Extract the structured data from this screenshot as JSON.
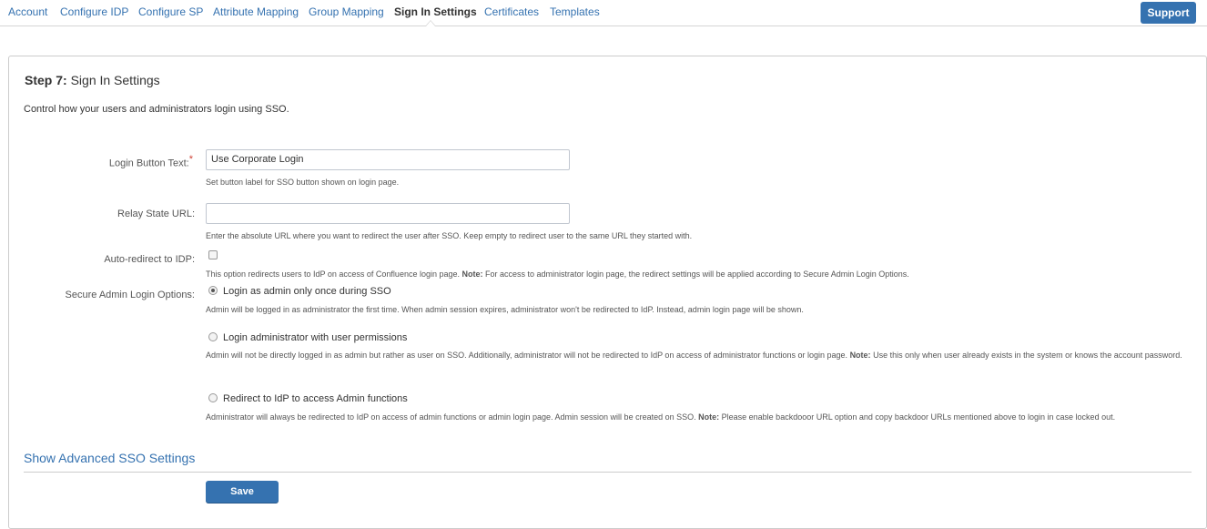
{
  "nav": {
    "tabs": [
      {
        "label": "Account"
      },
      {
        "label": "Configure IDP"
      },
      {
        "label": "Configure SP"
      },
      {
        "label": "Attribute Mapping"
      },
      {
        "label": "Group Mapping"
      },
      {
        "label": "Sign In Settings",
        "active": true
      },
      {
        "label": "Certificates"
      },
      {
        "label": "Templates"
      }
    ],
    "support_label": "Support"
  },
  "step": {
    "prefix": "Step 7:",
    "title": "Sign In Settings",
    "intro": "Control how your users and administrators login using SSO."
  },
  "fields": {
    "login_button_text": {
      "label": "Login Button Text:",
      "required_mark": "*",
      "value": "Use Corporate Login",
      "help": "Set button label for SSO button shown on login page."
    },
    "relay_state_url": {
      "label": "Relay State URL:",
      "value": "",
      "help": "Enter the absolute URL where you want to redirect the user after SSO. Keep empty to redirect user to the same URL they started with."
    },
    "auto_redirect": {
      "label": "Auto-redirect to IDP:",
      "checked": false,
      "help_pre": "This option redirects users to IdP on access of Confluence login page.",
      "help_note": "Note:",
      "help_post": "For access to administrator login page, the redirect settings will be applied according to Secure Admin Login Options."
    },
    "secure_admin": {
      "label": "Secure Admin Login Options:",
      "options": [
        {
          "label": "Login as admin only once during SSO",
          "checked": true,
          "help_pre": "Admin will be logged in as administrator the first time. When admin session expires, administrator won't be redirected to IdP. Instead, admin login page will be shown.",
          "help_note": "",
          "help_post": ""
        },
        {
          "label": "Login administrator with user permissions",
          "checked": false,
          "help_pre": "Admin will not be directly logged in as admin but rather as user on SSO. Additionally, administrator will not be redirected to IdP on access of administrator functions or login page.",
          "help_note": "Note:",
          "help_post": "Use this only when user already exists in the system or knows the account password."
        },
        {
          "label": "Redirect to IdP to access Admin functions",
          "checked": false,
          "help_pre": "Administrator will always be redirected to IdP on access of admin functions or admin login page. Admin session will be created on SSO.",
          "help_note": "Note:",
          "help_post": "Please enable backdooor URL option and copy backdoor URLs mentioned above to login in case locked out."
        }
      ]
    }
  },
  "advanced_link": "Show Advanced SSO Settings",
  "save_label": "Save",
  "colors": {
    "accent": "#3572b0",
    "required": "#d04437"
  }
}
